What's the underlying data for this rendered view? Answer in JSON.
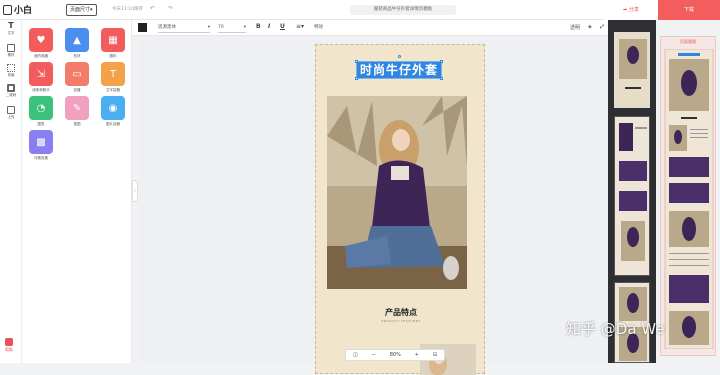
{
  "header": {
    "logo_text": "小白",
    "page_select": "页面尺寸▾",
    "saved_text": "今天11:10保存",
    "undo": "↶",
    "redo": "↷",
    "doc_title": "服装商品牛仔外套详情页模板",
    "share_label": "分享",
    "download_label": "下载"
  },
  "sidebar": {
    "items": [
      {
        "icon": "text-icon",
        "label": "文字"
      },
      {
        "icon": "material-icon",
        "label": "素材"
      },
      {
        "icon": "background-icon",
        "label": "背景"
      },
      {
        "icon": "qrcode-icon",
        "label": "二维码"
      },
      {
        "icon": "upload-icon",
        "label": "上传"
      }
    ],
    "help_label": "帮助"
  },
  "panel": {
    "tiles": [
      {
        "label": "我的收藏",
        "color": "#f25c5c",
        "glyph": "♥"
      },
      {
        "label": "形状",
        "color": "#4a8ef0",
        "glyph": "▲"
      },
      {
        "label": "图标",
        "color": "#f25c5c",
        "glyph": "▦"
      },
      {
        "label": "线条和箭头",
        "color": "#f25c5c",
        "glyph": "⇲"
      },
      {
        "label": "容器",
        "color": "#f27b6a",
        "glyph": "▭"
      },
      {
        "label": "文字容器",
        "color": "#f4a24a",
        "glyph": "T"
      },
      {
        "label": "图表",
        "color": "#3cc27a",
        "glyph": "◔"
      },
      {
        "label": "插图",
        "color": "#f2a0c0",
        "glyph": "✎"
      },
      {
        "label": "图片容器",
        "color": "#4aaef0",
        "glyph": "◉"
      },
      {
        "label": "马赛克素",
        "color": "#8a7ff0",
        "glyph": "▩"
      }
    ]
  },
  "toolbar": {
    "font": "思源黑体",
    "font_size": "70",
    "bold": "B",
    "italic": "I",
    "underline": "U",
    "align": "≡▾",
    "effect": "特效",
    "transparency": "透明",
    "layer": "◈"
  },
  "canvas": {
    "title_text": "时尚牛仔外套",
    "feature_title": "产品特点",
    "feature_subtitle": "PRODUCT FEATURES"
  },
  "zoom": {
    "zoom_out": "−",
    "zoom_value": "80%",
    "zoom_in": "+"
  },
  "thumbnails": {
    "page_mgmt": "页面管理"
  },
  "watermark": "知乎 @Da We"
}
